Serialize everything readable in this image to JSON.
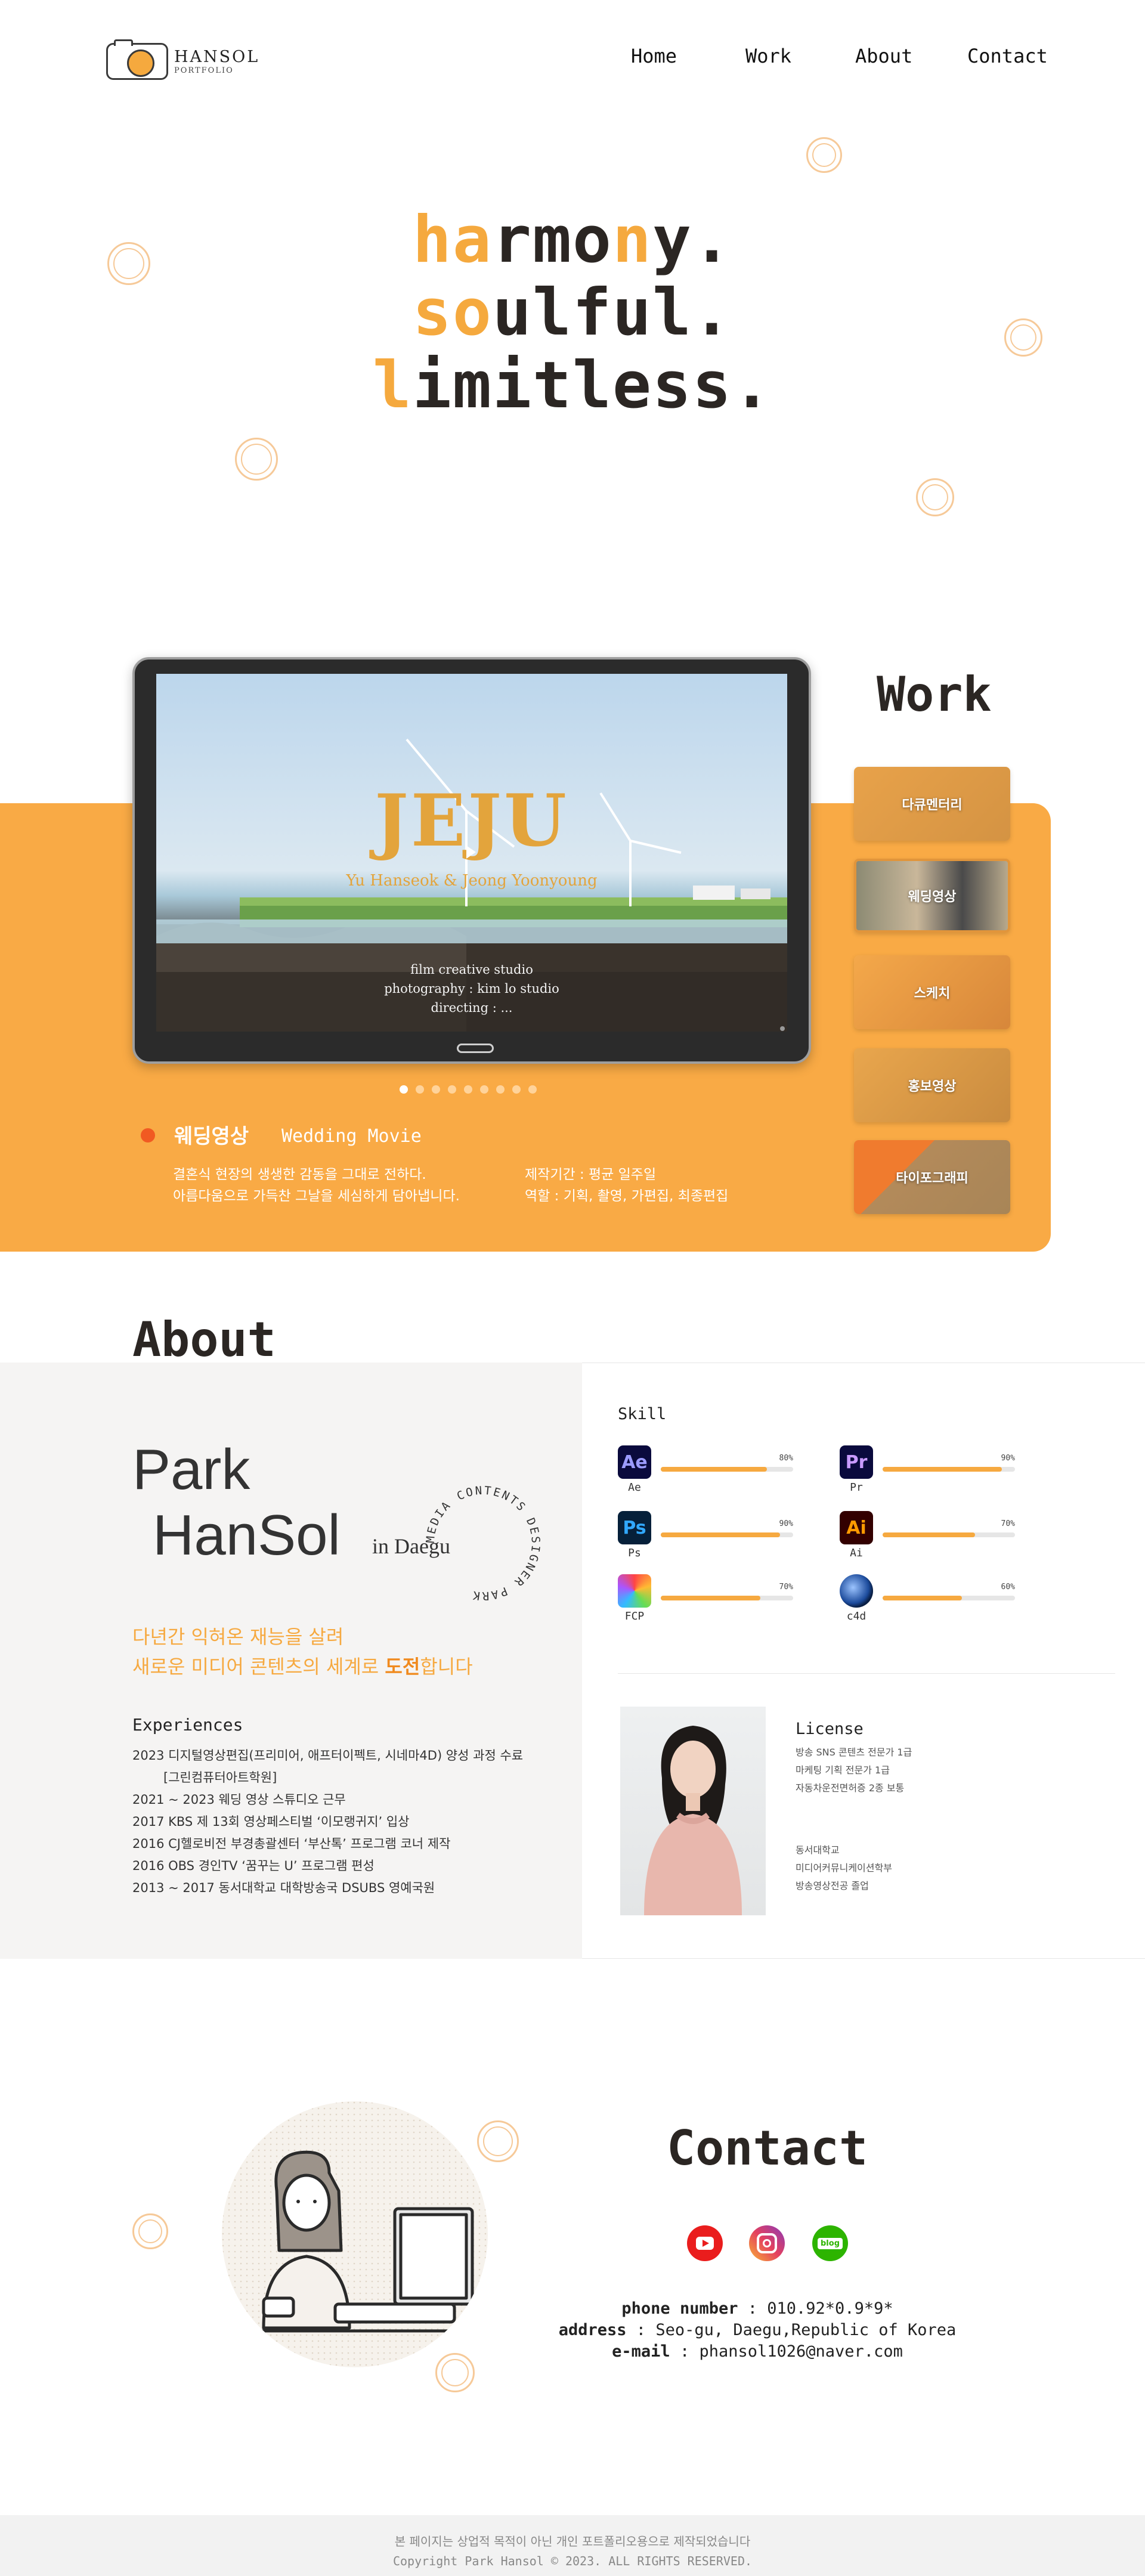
{
  "header": {
    "logo_name": "HANSOL",
    "logo_sub": "PORTFOLIO",
    "nav": [
      "Home",
      "Work",
      "About",
      "Contact"
    ]
  },
  "hero": {
    "line1": {
      "accent1": "ha",
      "plain1": "rmo",
      "accent2": "n",
      "plain2": "y."
    },
    "line2": {
      "accent": "so",
      "plain": "ulful."
    },
    "line3": {
      "accent": "l",
      "plain": "imitless."
    }
  },
  "work": {
    "title": "Work",
    "video": {
      "title": "JEJU",
      "subtitle": "Yu Hanseok & Jeong Yoonyoung",
      "credits": [
        "film creative studio",
        "photography : kim lo studio",
        "directing : ..."
      ]
    },
    "carousel": {
      "count": 9,
      "active": 0
    },
    "category_name": "웨딩영상",
    "category_en": "Wedding Movie",
    "desc_line1": "결혼식 현장의 생생한 감동을 그대로 전하다.",
    "desc_line2": "아름다움으로 가득찬 그날을 세심하게 담아냅니다.",
    "period": "제작기간 : 평균 일주일",
    "role": "역할 : 기획, 촬영, 가편집, 최종편집",
    "thumbs": [
      "다큐멘터리",
      "웨딩영상",
      "스케치",
      "홍보영상",
      "타이포그래피"
    ]
  },
  "about": {
    "title": "About",
    "name1": "Park",
    "name2": "HanSol",
    "location": "in Daegu",
    "stamp": "MEDIA CONTENTS DESIGNER PARK",
    "tagline1": "다년간 익혀온 재능을 살려",
    "tagline2_a": "새로운 미디어 콘텐츠의 세계로 ",
    "tagline2_b": "도전",
    "tagline2_c": "합니다",
    "exp_title": "Experiences",
    "experiences": [
      "2023 디지털영상편집(프리미어, 애프터이펙트, 시네마4D) 양성 과정 수료",
      "[그린컴퓨터아트학원]",
      "2021 ~ 2023 웨딩 영상 스튜디오 근무",
      "2017 KBS 제 13회 영상페스티벌 ‘이모랭귀지’ 입상",
      "2016 CJ헬로비전 부경총괄센터 ‘부산톡’ 프로그램 코너 제작",
      "2016 OBS 경인TV ‘꿈꾸는 U’ 프로그램 편성",
      "2013 ~ 2017 동서대학교 대학방송국 DSUBS 영예국원"
    ],
    "skill_title": "Skill",
    "skills": [
      {
        "abbr": "Ae",
        "label": "Ae",
        "pct": "80%",
        "level": 0.8
      },
      {
        "abbr": "Pr",
        "label": "Pr",
        "pct": "90%",
        "level": 0.9
      },
      {
        "abbr": "Ps",
        "label": "Ps",
        "pct": "90%",
        "level": 0.9
      },
      {
        "abbr": "Ai",
        "label": "Ai",
        "pct": "70%",
        "level": 0.7
      },
      {
        "abbr": "",
        "label": "FCP",
        "pct": "70%",
        "level": 0.75
      },
      {
        "abbr": "",
        "label": "c4d",
        "pct": "60%",
        "level": 0.6
      }
    ],
    "license_title": "License",
    "licenses": [
      "방송 SNS 콘텐츠 전문가 1급",
      "마케팅 기획 전문가 1급",
      "자동차운전면허증 2종 보통"
    ],
    "education": [
      "동서대학교",
      "미디어커뮤니케이션학부",
      "방송영상전공 졸업"
    ]
  },
  "contact": {
    "title": "Contact",
    "phone_label": "phone number",
    "phone": "010.92*0.9*9*",
    "address_label": "address",
    "address": "Seo-gu, Daegu,Republic of Korea",
    "email_label": "e-mail",
    "email": "phansol1026@naver.com",
    "social_blog": "blog"
  },
  "footer": {
    "line1": "본 페이지는 상업적 목적이 아닌 개인 포트폴리오용으로 제작되었습니다",
    "line2": "Copyright Park Hansol © 2023. ALL RIGHTS RESERVED."
  },
  "colors": {
    "accent": "#f9aa45",
    "dark": "#2b2623"
  }
}
